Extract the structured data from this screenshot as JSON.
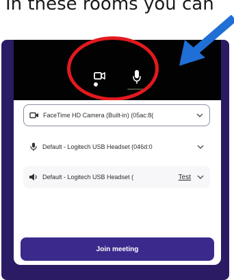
{
  "caption": {
    "text": "In these rooms you can"
  },
  "preview": {
    "camera_icon": "camera-off-icon",
    "mic_icon": "microphone-icon"
  },
  "annotation": {
    "circle_color": "#e3191f",
    "arrow_color": "#1f6fd6"
  },
  "devices": {
    "camera": {
      "label": "FaceTime HD Camera (Built-in) (05ac:8(",
      "icon": "video-camera-icon"
    },
    "microphone": {
      "label": "Default - Logitech USB Headset (046d:0",
      "icon": "microphone-icon"
    },
    "speaker": {
      "label": "Default - Logitech USB Headset (",
      "icon": "speaker-icon",
      "test_label": "Test"
    }
  },
  "join": {
    "label": "Join meeting"
  },
  "colors": {
    "frame": "#2b1b64",
    "button": "#3b2a8c",
    "preview": "#020202"
  }
}
